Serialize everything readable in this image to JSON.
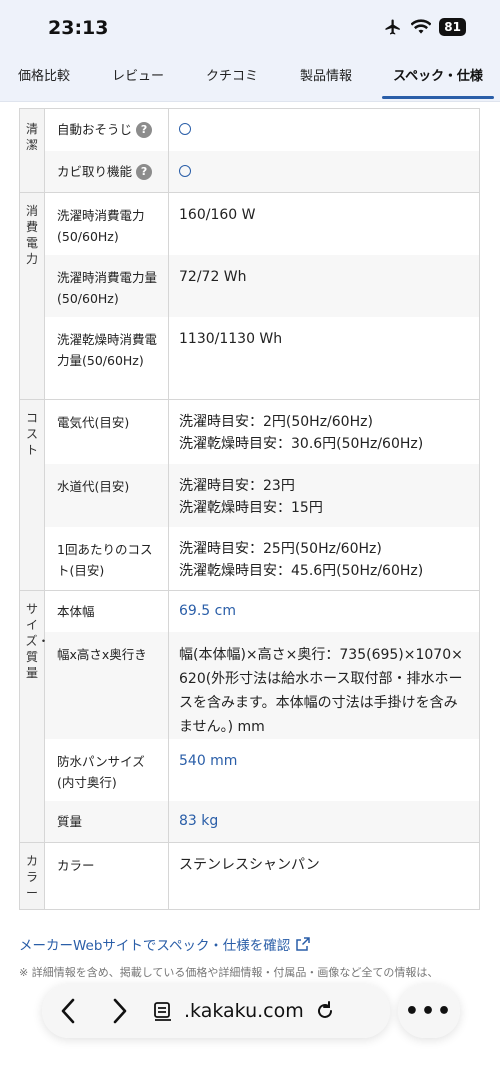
{
  "status": {
    "time": "23:13",
    "battery": "81",
    "icons": [
      "airplane-icon",
      "wifi-icon",
      "battery-icon"
    ]
  },
  "tabs": [
    {
      "label": "価格比較",
      "active": false
    },
    {
      "label": "レビュー",
      "active": false
    },
    {
      "label": "クチコミ",
      "active": false
    },
    {
      "label": "製品情報",
      "active": false
    },
    {
      "label": "スペック・仕様",
      "active": true
    }
  ],
  "spec_groups": [
    {
      "label": "清潔",
      "rows": [
        {
          "label": "自動おそうじ",
          "help": "?",
          "value_icon": "circle-icon"
        },
        {
          "label": "カビ取り機能",
          "help": "?",
          "value_icon": "circle-icon"
        }
      ]
    },
    {
      "label": "消費電力",
      "rows": [
        {
          "label": "洗濯時消費電力(50/60Hz)",
          "value": "160/160 W"
        },
        {
          "label": "洗濯時消費電力量(50/60Hz)",
          "value": "72/72 Wh"
        },
        {
          "label": "洗濯乾燥時消費電力量(50/60Hz)",
          "value": "1130/1130 Wh"
        }
      ]
    },
    {
      "label": "コスト",
      "rows": [
        {
          "label": "電気代(目安)",
          "value_lines": [
            "洗濯時目安：2円(50Hz/60Hz)",
            "洗濯乾燥時目安：30.6円(50Hz/60Hz)"
          ]
        },
        {
          "label": "水道代(目安)",
          "value_lines": [
            "洗濯時目安：23円",
            "洗濯乾燥時目安：15円"
          ]
        },
        {
          "label": "1回あたりのコスト(目安)",
          "value_lines": [
            "洗濯時目安：25円(50Hz/60Hz)",
            "洗濯乾燥時目安：45.6円(50Hz/60Hz)"
          ]
        }
      ]
    },
    {
      "label": "サイズ・質量",
      "rows": [
        {
          "label": "本体幅",
          "value": "69.5 cm",
          "link": true
        },
        {
          "label": "幅x高さx奥行き",
          "value": "幅(本体幅)×高さ×奥行：735(695)×1070×620(外形寸法は給水ホース取付部・排水ホースを含みます。本体幅の寸法は手掛けを含みません。) mm"
        },
        {
          "label": "防水パンサイズ(内寸奥行)",
          "value": "540 mm",
          "link": true
        },
        {
          "label": "質量",
          "value": "83 kg",
          "link": true
        }
      ]
    },
    {
      "label": "カラー",
      "rows": [
        {
          "label": "カラー",
          "value": "ステンレスシャンパン"
        }
      ]
    }
  ],
  "maker_link": {
    "label": "メーカーWebサイトでスペック・仕様を確認",
    "icon": "external-link-icon"
  },
  "notes": [
    "※ 詳細情報を含め、掲載している価格や詳細情報・付属品・画像など全ての情報は、"
  ],
  "browser": {
    "url": ".kakaku.com",
    "icons": [
      "back-icon",
      "forward-icon",
      "reader-icon",
      "reload-icon",
      "more-icon"
    ],
    "more_label": "•••"
  },
  "colors": {
    "accent": "#2a5ea8",
    "header_bg": "#eef2fa",
    "label_bg": "#f4f4f4"
  }
}
